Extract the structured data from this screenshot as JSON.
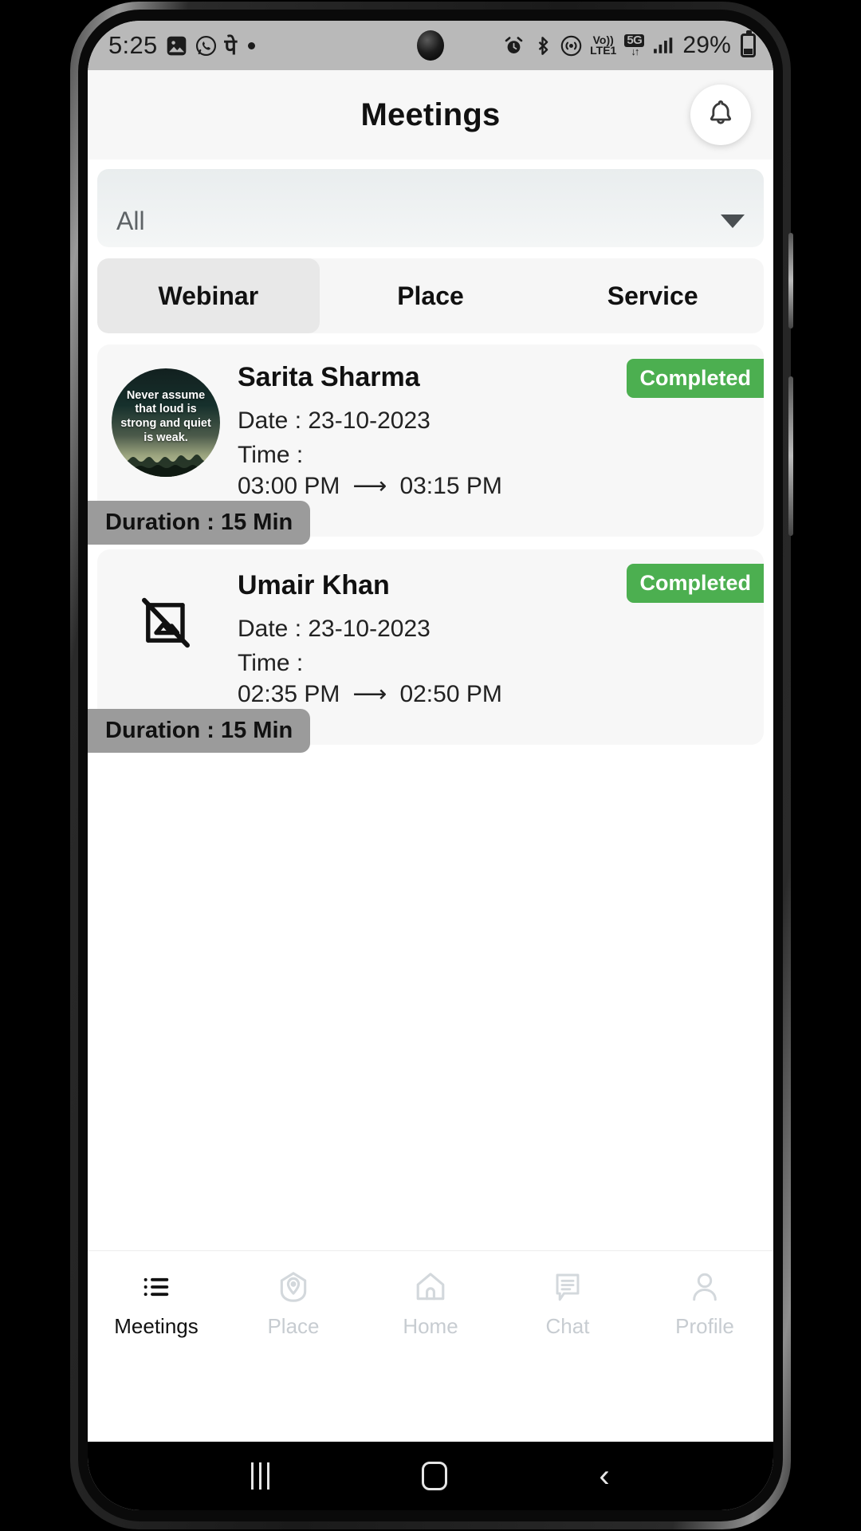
{
  "status_bar": {
    "time": "5:25",
    "left_icons": [
      "photos-icon",
      "whatsapp-icon",
      "phonepe-icon",
      "status-dot"
    ],
    "phonepe_glyph": "पे",
    "right_icons": [
      "alarm-icon",
      "bluetooth-icon",
      "hotspot-icon"
    ],
    "volte_top": "Vo))",
    "volte_bottom": "LTE1",
    "network_label": "5G",
    "network_arrows": "↓↑",
    "signal_icon": "signal-bars-icon",
    "battery_percent": "29%"
  },
  "header": {
    "title": "Meetings",
    "notification_icon": "bell-icon"
  },
  "filter": {
    "selected": "All",
    "caret_icon": "chevron-down-icon"
  },
  "tabs": [
    {
      "label": "Webinar",
      "active": true
    },
    {
      "label": "Place",
      "active": false
    },
    {
      "label": "Service",
      "active": false
    }
  ],
  "meetings": [
    {
      "name": "Sarita Sharma",
      "date_label": "Date : 23-10-2023",
      "time_label": "Time :",
      "start_time": "03:00 PM",
      "arrow": "⟶",
      "end_time": "03:15 PM",
      "status": "Completed",
      "status_color": "#4caf50",
      "duration": "Duration : 15 Min",
      "avatar_type": "photo",
      "avatar_quote": "Never assume that loud is strong and quiet is weak."
    },
    {
      "name": "Umair Khan",
      "date_label": "Date : 23-10-2023",
      "time_label": "Time :",
      "start_time": "02:35 PM",
      "arrow": "⟶",
      "end_time": "02:50 PM",
      "status": "Completed",
      "status_color": "#4caf50",
      "duration": "Duration : 15 Min",
      "avatar_type": "broken-image",
      "avatar_quote": ""
    }
  ],
  "bottom_nav": [
    {
      "label": "Meetings",
      "icon": "list-icon",
      "active": true
    },
    {
      "label": "Place",
      "icon": "location-pin-icon",
      "active": false
    },
    {
      "label": "Home",
      "icon": "home-icon",
      "active": false
    },
    {
      "label": "Chat",
      "icon": "chat-bubble-icon",
      "active": false
    },
    {
      "label": "Profile",
      "icon": "person-icon",
      "active": false
    }
  ],
  "android_nav": {
    "recents": "recents-icon",
    "home": "home-button-icon",
    "back": "‹"
  }
}
